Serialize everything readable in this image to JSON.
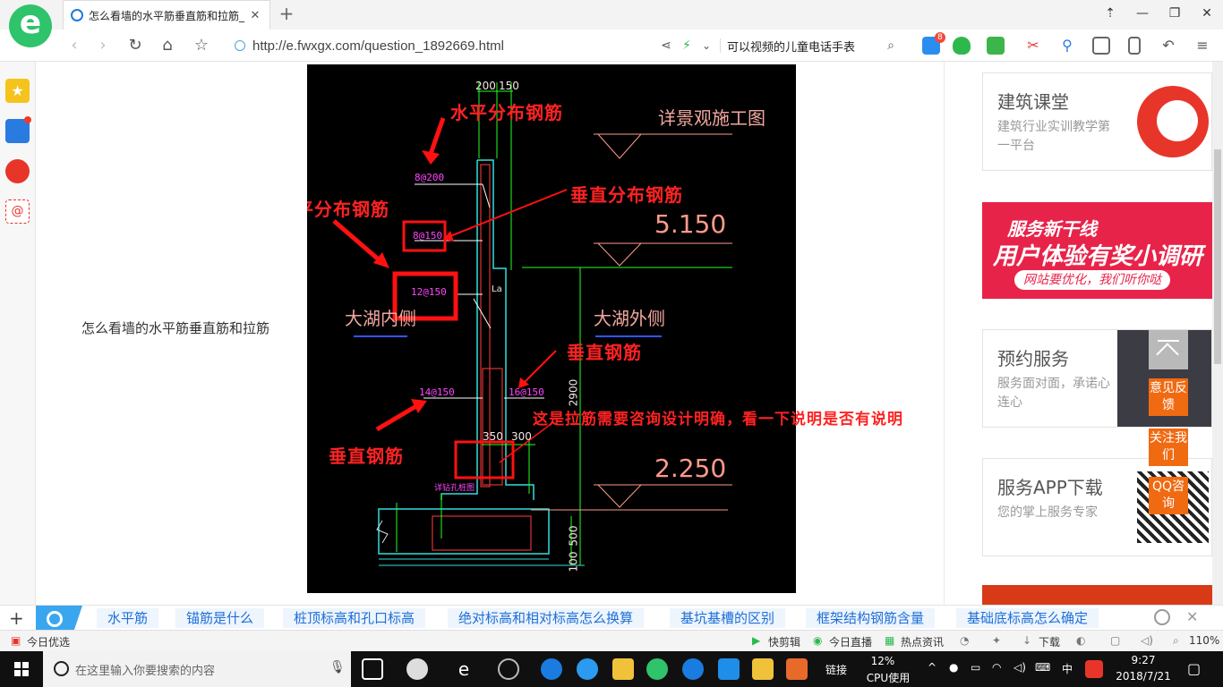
{
  "browser": {
    "tab_title": "怎么看墙的水平筋垂直筋和拉筋_",
    "url": "http://e.fwxgx.com/question_1892669.html",
    "search_value": "可以视频的儿童电话手表",
    "tb_badge": "8",
    "window_controls": [
      "⇡",
      "—",
      "❐",
      "✕"
    ]
  },
  "page": {
    "question_text": "怎么看墙的水平筋垂直筋和拉筋",
    "cad": {
      "red_labels": [
        "水平分布钢筋",
        "水平分布钢筋",
        "垂直分布钢筋",
        "垂直钢筋",
        "垂直钢筋"
      ],
      "note": "这是拉筋需要咨询设计明确，看一下说明是否有说明",
      "rebar_labels": [
        "8@200",
        "8@150",
        "12@150",
        "14@150",
        "16@150"
      ],
      "dims": [
        "200",
        "150",
        "350",
        "300",
        "2900",
        "500",
        "100",
        "La"
      ],
      "elevations": [
        "5.150",
        "2.250"
      ],
      "annotations": [
        "详景观施工图",
        "大湖内侧",
        "大湖外侧",
        "详钻孔桩图"
      ]
    },
    "cards": [
      {
        "title": "建筑课堂",
        "desc": "建筑行业实训教学第一平台"
      },
      {
        "title": "预约服务",
        "desc": "服务面对面，承诺心连心"
      },
      {
        "title": "服务APP下载",
        "desc": "您的掌上服务专家"
      }
    ],
    "banner": {
      "line1": "服务新干线",
      "line2": "用户体验有奖小调研",
      "line3": "网站要优化，我们听你哒"
    },
    "float_buttons": [
      "意见反馈",
      "关注我们",
      "QQ咨询"
    ]
  },
  "related": {
    "items": [
      "水平筋",
      "锚筋是什么",
      "桩顶标高和孔口标高",
      "绝对标高和相对标高怎么换算",
      "基坑基槽的区别",
      "框架结构钢筋含量",
      "基础底标高怎么确定"
    ]
  },
  "statusbar": {
    "left": "今日优选",
    "items": [
      "快剪辑",
      "今日直播",
      "热点资讯",
      "下载"
    ],
    "zoom": "110%"
  },
  "taskbar": {
    "search_placeholder": "在这里输入你要搜索的内容",
    "link_label": "链接",
    "cpu_percent": "12%",
    "cpu_label": "CPU使用",
    "ime": "中",
    "time": "9:27",
    "date": "2018/7/21"
  },
  "colors": {
    "cad_bg": "#000000",
    "accent_blue": "#1e6fd9",
    "float_orange": "#f06a12"
  }
}
